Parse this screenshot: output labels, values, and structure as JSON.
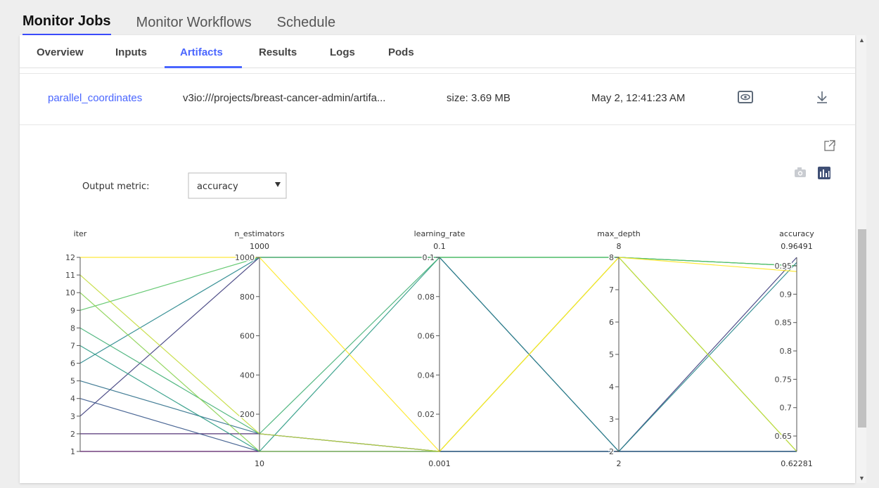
{
  "top_tabs": [
    "Monitor Jobs",
    "Monitor Workflows",
    "Schedule"
  ],
  "sub_tabs": [
    "Overview",
    "Inputs",
    "Artifacts",
    "Results",
    "Logs",
    "Pods"
  ],
  "artifact": {
    "name": "parallel_coordinates",
    "path": "v3io:///projects/breast-cancer-admin/artifa...",
    "size": "size: 3.69 MB",
    "date": "May 2, 12:41:23 AM"
  },
  "output_metric": {
    "label": "Output metric:",
    "value": "accuracy"
  },
  "icons": {
    "preview": "eye-icon",
    "download": "download-icon",
    "open": "external-link-icon",
    "camera": "camera-icon",
    "plotly": "plotly-logo-icon"
  },
  "chart_data": {
    "type": "parallel_coordinates",
    "dimensions": [
      {
        "name": "iter",
        "min": 1,
        "max": 12,
        "ticks": [
          "1",
          "2",
          "3",
          "4",
          "5",
          "6",
          "7",
          "8",
          "9",
          "10",
          "11",
          "12"
        ]
      },
      {
        "name": "n_estimators",
        "min": 10,
        "max": 1000,
        "range_labels": [
          "10",
          "1000"
        ],
        "ticks": [
          "200",
          "400",
          "600",
          "800",
          "1000"
        ]
      },
      {
        "name": "learning_rate",
        "min": 0.001,
        "max": 0.1,
        "range_labels": [
          "0.001",
          "0.1"
        ],
        "ticks": [
          "0.02",
          "0.04",
          "0.06",
          "0.08",
          "0.1"
        ]
      },
      {
        "name": "max_depth",
        "min": 2,
        "max": 8,
        "range_labels": [
          "2",
          "8"
        ],
        "ticks": [
          "2",
          "3",
          "4",
          "5",
          "6",
          "7",
          "8"
        ]
      },
      {
        "name": "accuracy",
        "min": 0.62281,
        "max": 0.96491,
        "range_labels": [
          "0.62281",
          "0.96491"
        ],
        "ticks": [
          "0.65",
          "0.7",
          "0.75",
          "0.8",
          "0.85",
          "0.9",
          "0.95"
        ]
      }
    ],
    "rows": [
      {
        "iter": 1,
        "n_estimators": 10,
        "learning_rate": 0.001,
        "max_depth": 2,
        "accuracy": 0.62281,
        "accuracy_value": 0.62281
      },
      {
        "iter": 2,
        "n_estimators": 100,
        "learning_rate": 0.001,
        "max_depth": 2,
        "accuracy": 0.62281,
        "accuracy_value": 0.62281
      },
      {
        "iter": 3,
        "n_estimators": 1000,
        "learning_rate": 0.1,
        "max_depth": 2,
        "accuracy": 0.96491,
        "accuracy_value": 0.96491
      },
      {
        "iter": 4,
        "n_estimators": 10,
        "learning_rate": 0.001,
        "max_depth": 2,
        "accuracy": 0.62281,
        "accuracy_value": 0.62281
      },
      {
        "iter": 5,
        "n_estimators": 100,
        "learning_rate": 0.001,
        "max_depth": 2,
        "accuracy": 0.62281,
        "accuracy_value": 0.62281
      },
      {
        "iter": 6,
        "n_estimators": 1000,
        "learning_rate": 0.1,
        "max_depth": 2,
        "accuracy": 0.956,
        "accuracy_value": 0.956
      },
      {
        "iter": 7,
        "n_estimators": 10,
        "learning_rate": 0.1,
        "max_depth": 8,
        "accuracy": 0.95,
        "accuracy_value": 0.95
      },
      {
        "iter": 8,
        "n_estimators": 100,
        "learning_rate": 0.1,
        "max_depth": 8,
        "accuracy": 0.95,
        "accuracy_value": 0.95
      },
      {
        "iter": 9,
        "n_estimators": 1000,
        "learning_rate": 0.1,
        "max_depth": 8,
        "accuracy": 0.95,
        "accuracy_value": 0.95
      },
      {
        "iter": 10,
        "n_estimators": 10,
        "learning_rate": 0.001,
        "max_depth": 8,
        "accuracy": 0.62281,
        "accuracy_value": 0.62281
      },
      {
        "iter": 11,
        "n_estimators": 100,
        "learning_rate": 0.001,
        "max_depth": 8,
        "accuracy": 0.62281,
        "accuracy_value": 0.62281
      },
      {
        "iter": 12,
        "n_estimators": 1000,
        "learning_rate": 0.001,
        "max_depth": 8,
        "accuracy": 0.94,
        "accuracy_value": 0.94
      }
    ],
    "colorscale": [
      "#440154",
      "#3b528b",
      "#21918c",
      "#5ec962",
      "#fde725"
    ],
    "color_by": "accuracy"
  }
}
